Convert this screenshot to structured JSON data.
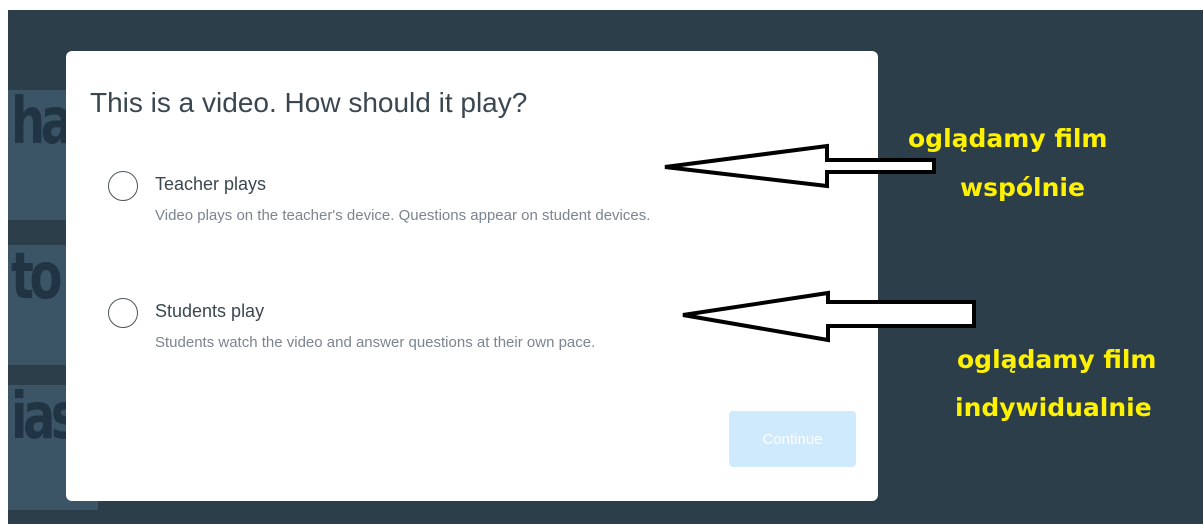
{
  "background": {
    "slide_fragments": [
      "ha",
      "to",
      "ias"
    ]
  },
  "dialog": {
    "title": "This is a video. How should it play?",
    "options": [
      {
        "label": "Teacher plays",
        "description": "Video plays on the teacher's device. Questions appear on student devices.",
        "selected": false
      },
      {
        "label": "Students play",
        "description": "Students watch the video and answer questions at their own pace.",
        "selected": false
      }
    ],
    "continue_label": "Continue",
    "continue_enabled": false
  },
  "annotations": {
    "teacher_note_line1": "oglądamy film",
    "teacher_note_line2": "wspólnie",
    "students_note_line1": "oglądamy film",
    "students_note_line2": "indywidualnie",
    "note_color": "#fff200",
    "arrow_color": "#000000"
  },
  "colors": {
    "backdrop": "#2c3e4a",
    "button_disabled": "#cfeafc"
  }
}
